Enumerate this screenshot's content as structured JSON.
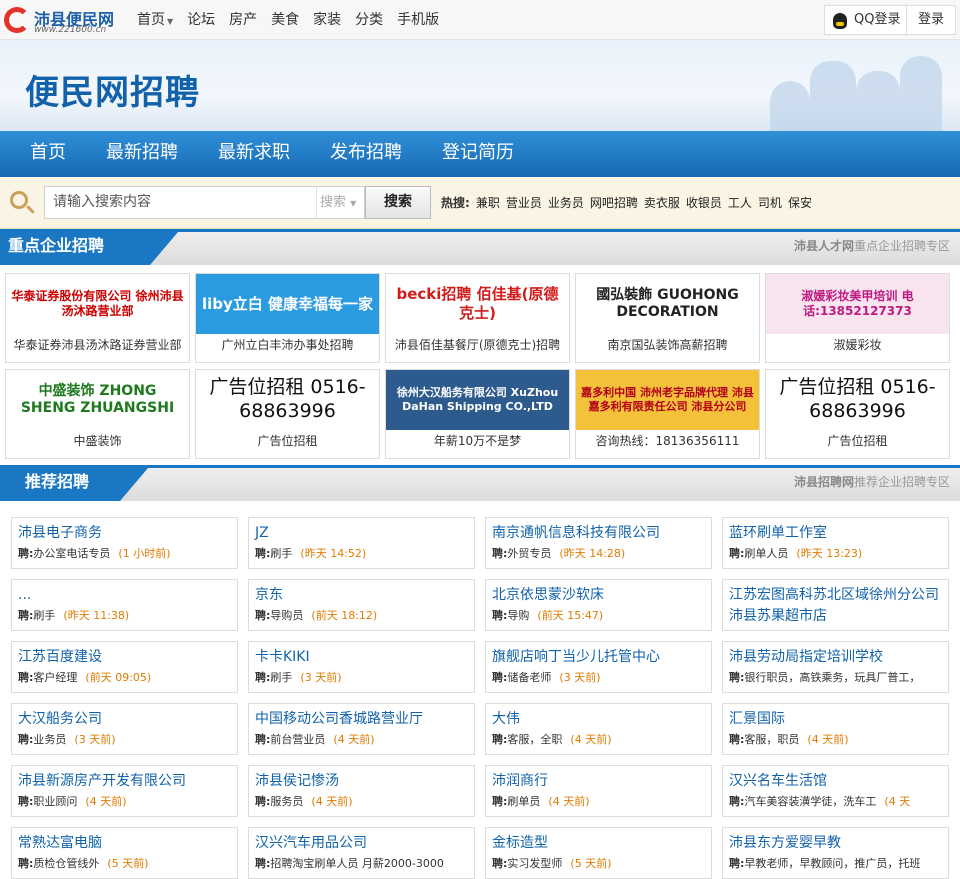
{
  "site": {
    "logo_name": "沛县便民网",
    "logo_url": "www.221600.cn",
    "banner_title": "便民网招聘"
  },
  "topnav": [
    "首页",
    "论坛",
    "房产",
    "美食",
    "家装",
    "分类",
    "手机版"
  ],
  "topbar_right": {
    "qq_login": "QQ登录",
    "login": "登录"
  },
  "mainnav": [
    "首页",
    "最新招聘",
    "最新求职",
    "发布招聘",
    "登记简历"
  ],
  "search": {
    "placeholder": "请输入搜索内容",
    "select_value": "搜索",
    "button": "搜索",
    "hot_label": "热搜:",
    "hot": [
      "兼职",
      "营业员",
      "业务员",
      "网吧招聘",
      "卖衣服",
      "收银员",
      "工人",
      "司机",
      "保安"
    ]
  },
  "section1": {
    "title": "重点企业招聘",
    "right_bold": "沛县人才网",
    "right_text": "重点企业招聘专区"
  },
  "ads": [
    {
      "img": "华泰证券股份有限公司 徐州沛县汤沐路营业部",
      "caption": "华泰证券沛县汤沐路证券营业部",
      "style": "ht"
    },
    {
      "img": "liby立白 健康幸福每一家",
      "caption": "广州立白丰沛办事处招聘",
      "style": "liby"
    },
    {
      "img": "becki招聘 佰佳基(原德克士)",
      "caption": "沛县佰佳基餐厅(原德克士)招聘",
      "style": "becki"
    },
    {
      "img": "國弘裝飾 GUOHONG DECORATION",
      "caption": "南京国弘装饰高薪招聘",
      "style": "gh"
    },
    {
      "img": "淑媛彩妆美甲培训 电话:13852127373",
      "caption": "淑媛彩妆",
      "style": "sy"
    },
    {
      "img": "中盛装饰 ZHONG SHENG ZHUANGSHI",
      "caption": "中盛装饰",
      "style": "zs"
    },
    {
      "img": "广告位招租 0516-68863996",
      "caption": "广告位招租",
      "style": "ad"
    },
    {
      "img": "徐州大汉船务有限公司 XuZhou DaHan Shipping CO.,LTD",
      "caption": "年薪10万不是梦",
      "style": "dh"
    },
    {
      "img": "嘉多利中国 沛州老字品牌代理 沛县嘉多利有限责任公司 沛县分公司",
      "caption": "咨询热线：18136356111",
      "style": "jdl"
    },
    {
      "img": "广告位招租 0516-68863996",
      "caption": "广告位招租",
      "style": "ad"
    }
  ],
  "section2": {
    "title": "推荐招聘",
    "right_bold": "沛县招聘网",
    "right_text": "推荐企业招聘专区"
  },
  "jobs": [
    {
      "company": "沛县电子商务",
      "prefix": "聘:",
      "job": "办公室电话专员",
      "time": "(1 小时前)"
    },
    {
      "company": "JZ",
      "prefix": "聘:",
      "job": "刷手",
      "time": "(昨天 14:52)"
    },
    {
      "company": "南京通帆信息科技有限公司",
      "prefix": "聘:",
      "job": "外贸专员",
      "time": "(昨天 14:28)"
    },
    {
      "company": "蓝环刷单工作室",
      "prefix": "聘:",
      "job": "刷单人员",
      "time": "(昨天 13:23)"
    },
    {
      "company": "...",
      "prefix": "聘:",
      "job": "刷手",
      "time": "(昨天 11:38)"
    },
    {
      "company": "京东",
      "prefix": "聘:",
      "job": "导购员",
      "time": "(前天 18:12)"
    },
    {
      "company": "北京依思蒙沙软床",
      "prefix": "聘:",
      "job": "导购",
      "time": "(前天 15:47)"
    },
    {
      "company": "江苏宏图高科苏北区域徐州分公司沛县苏果超市店",
      "prefix": "",
      "job": "",
      "time": ""
    },
    {
      "company": "江苏百度建设",
      "prefix": "聘:",
      "job": "客户经理",
      "time": "(前天 09:05)"
    },
    {
      "company": "卡卡KIKI",
      "prefix": "聘:",
      "job": "刷手",
      "time": "(3 天前)"
    },
    {
      "company": "旗舰店响丁当少儿托管中心",
      "prefix": "聘:",
      "job": "储备老师",
      "time": "(3 天前)"
    },
    {
      "company": "沛县劳动局指定培训学校",
      "prefix": "聘:",
      "job": "银行职员，高铁乘务，玩具厂普工，",
      "time": ""
    },
    {
      "company": "大汉船务公司",
      "prefix": "聘:",
      "job": "业务员",
      "time": "(3 天前)"
    },
    {
      "company": "中国移动公司香城路营业厅",
      "prefix": "聘:",
      "job": "前台营业员",
      "time": "(4 天前)"
    },
    {
      "company": "大伟",
      "prefix": "聘:",
      "job": "客服，全职",
      "time": "(4 天前)"
    },
    {
      "company": "汇景国际",
      "prefix": "聘:",
      "job": "客服，职员",
      "time": "(4 天前)"
    },
    {
      "company": "沛县新源房产开发有限公司",
      "prefix": "聘:",
      "job": "职业顾问",
      "time": "(4 天前)"
    },
    {
      "company": "沛县侯记惨汤",
      "prefix": "聘:",
      "job": "服务员",
      "time": "(4 天前)"
    },
    {
      "company": "沛润商行",
      "prefix": "聘:",
      "job": "刷单员",
      "time": "(4 天前)"
    },
    {
      "company": "汉兴名车生活馆",
      "prefix": "聘:",
      "job": "汽车美容装潢学徒，洗车工",
      "time": "(4 天"
    },
    {
      "company": "常熟达富电脑",
      "prefix": "聘:",
      "job": "质检仓管线外",
      "time": "(5 天前)"
    },
    {
      "company": "汉兴汽车用品公司",
      "prefix": "聘:",
      "job": "招聘淘宝刷单人员 月薪2000-3000",
      "time": ""
    },
    {
      "company": "金标造型",
      "prefix": "聘:",
      "job": "实习发型师",
      "time": "(5 天前)"
    },
    {
      "company": "沛县东方爱婴早教",
      "prefix": "聘:",
      "job": "早教老师，早教顾问，推广员，托班",
      "time": ""
    }
  ]
}
